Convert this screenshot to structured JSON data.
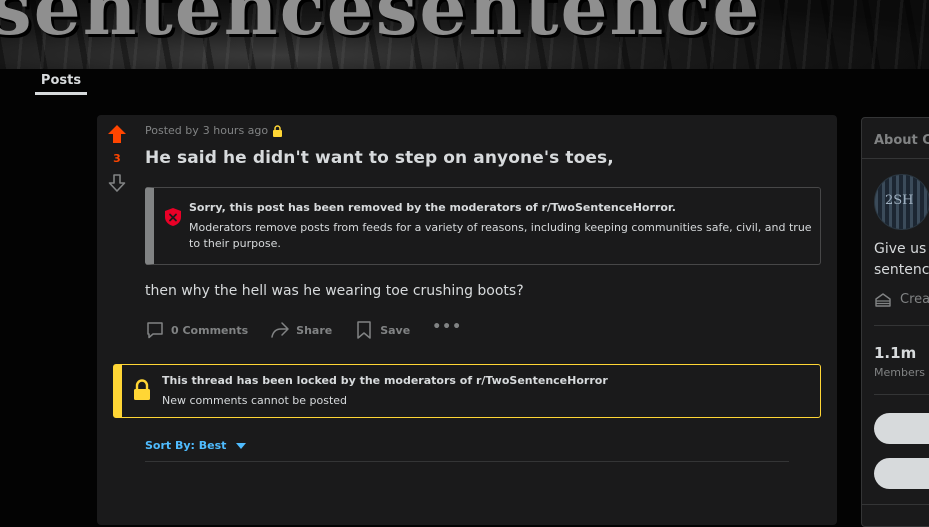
{
  "banner": {
    "title_fragment": "sentencesentence"
  },
  "tabs": {
    "posts": "Posts"
  },
  "post": {
    "score": "3",
    "posted_by": "Posted by",
    "time_ago": "3 hours ago",
    "title": "He said he didn't want to step on anyone's toes,",
    "removed_notice": {
      "title": "Sorry, this post has been removed by the moderators of r/TwoSentenceHorror.",
      "body": "Moderators remove posts from feeds for a variety of reasons, including keeping communities safe, civil, and true to their purpose."
    },
    "body": "then why the hell was he wearing toe crushing boots?",
    "actions": {
      "comments": "0 Comments",
      "share": "Share",
      "save": "Save",
      "more": "•••"
    },
    "locked_notice": {
      "title": "This thread has been locked by the moderators of r/TwoSentenceHorror",
      "body": "New comments cannot be posted"
    },
    "sort": {
      "label": "Sort By: Best"
    }
  },
  "sidebar": {
    "about": "About C",
    "avatar_text": "2SH",
    "description_line1": "Give us y",
    "description_line2": "sentence",
    "created": "Crea",
    "members_count": "1.1m",
    "members_label": "Members"
  },
  "colors": {
    "upvote": "#ff4500",
    "link_blue": "#4fbcff",
    "locked_yellow": "#ffd635",
    "removed_red": "#ea0027",
    "card_bg": "#1a1a1b",
    "page_bg": "#030303"
  }
}
